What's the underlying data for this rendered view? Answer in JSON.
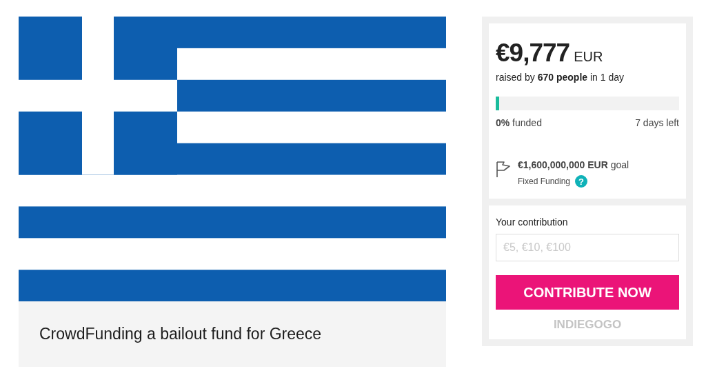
{
  "campaign": {
    "title": "CrowdFunding a bailout fund for Greece"
  },
  "funding": {
    "amount": "€9,777",
    "currency": "EUR",
    "raised": "raised by **670 people** in 1 day",
    "level": 0.02,
    "funded": "**0%** funded",
    "days_left": "7 days left",
    "goal": "**€1,600,000,000 EUR** goal",
    "funding_type": "Fixed Funding",
    "help": "?"
  },
  "contribution": {
    "label": "Your contribution",
    "placeholder": "€5, €10, €100",
    "button": "CONTRIBUTE NOW",
    "brand": "INDIEGOGO"
  }
}
